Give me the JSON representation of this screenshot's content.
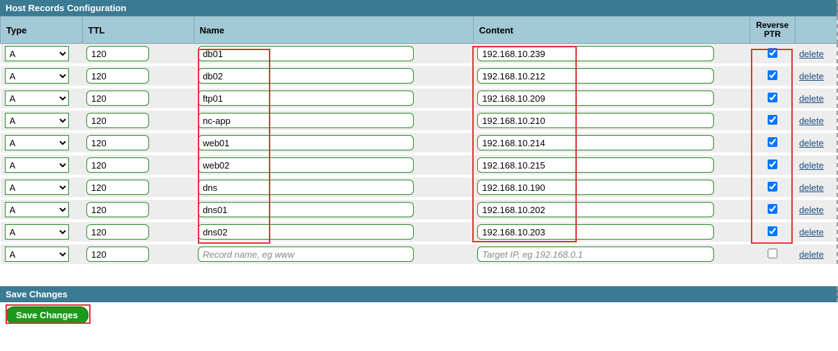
{
  "panel_title": "Host Records Configuration",
  "columns": {
    "type": "Type",
    "ttl": "TTL",
    "name": "Name",
    "content": "Content",
    "reverse": "Reverse PTR"
  },
  "type_options": [
    "A"
  ],
  "rows": [
    {
      "type": "A",
      "ttl": "120",
      "name": "db01",
      "content": "192.168.10.239",
      "reverse": true
    },
    {
      "type": "A",
      "ttl": "120",
      "name": "db02",
      "content": "192.168.10.212",
      "reverse": true
    },
    {
      "type": "A",
      "ttl": "120",
      "name": "ftp01",
      "content": "192.168.10.209",
      "reverse": true
    },
    {
      "type": "A",
      "ttl": "120",
      "name": "nc-app",
      "content": "192.168.10.210",
      "reverse": true
    },
    {
      "type": "A",
      "ttl": "120",
      "name": "web01",
      "content": "192.168.10.214",
      "reverse": true
    },
    {
      "type": "A",
      "ttl": "120",
      "name": "web02",
      "content": "192.168.10.215",
      "reverse": true
    },
    {
      "type": "A",
      "ttl": "120",
      "name": "dns",
      "content": "192.168.10.190",
      "reverse": true
    },
    {
      "type": "A",
      "ttl": "120",
      "name": "dns01",
      "content": "192.168.10.202",
      "reverse": true
    },
    {
      "type": "A",
      "ttl": "120",
      "name": "dns02",
      "content": "192.168.10.203",
      "reverse": true
    }
  ],
  "new_row": {
    "type": "A",
    "ttl": "120",
    "name_placeholder": "Record name, eg www",
    "content_placeholder": "Target IP, eg 192.168.0.1",
    "reverse": false
  },
  "delete_label": "delete",
  "save_section_title": "Save Changes",
  "save_button_label": "Save Changes"
}
